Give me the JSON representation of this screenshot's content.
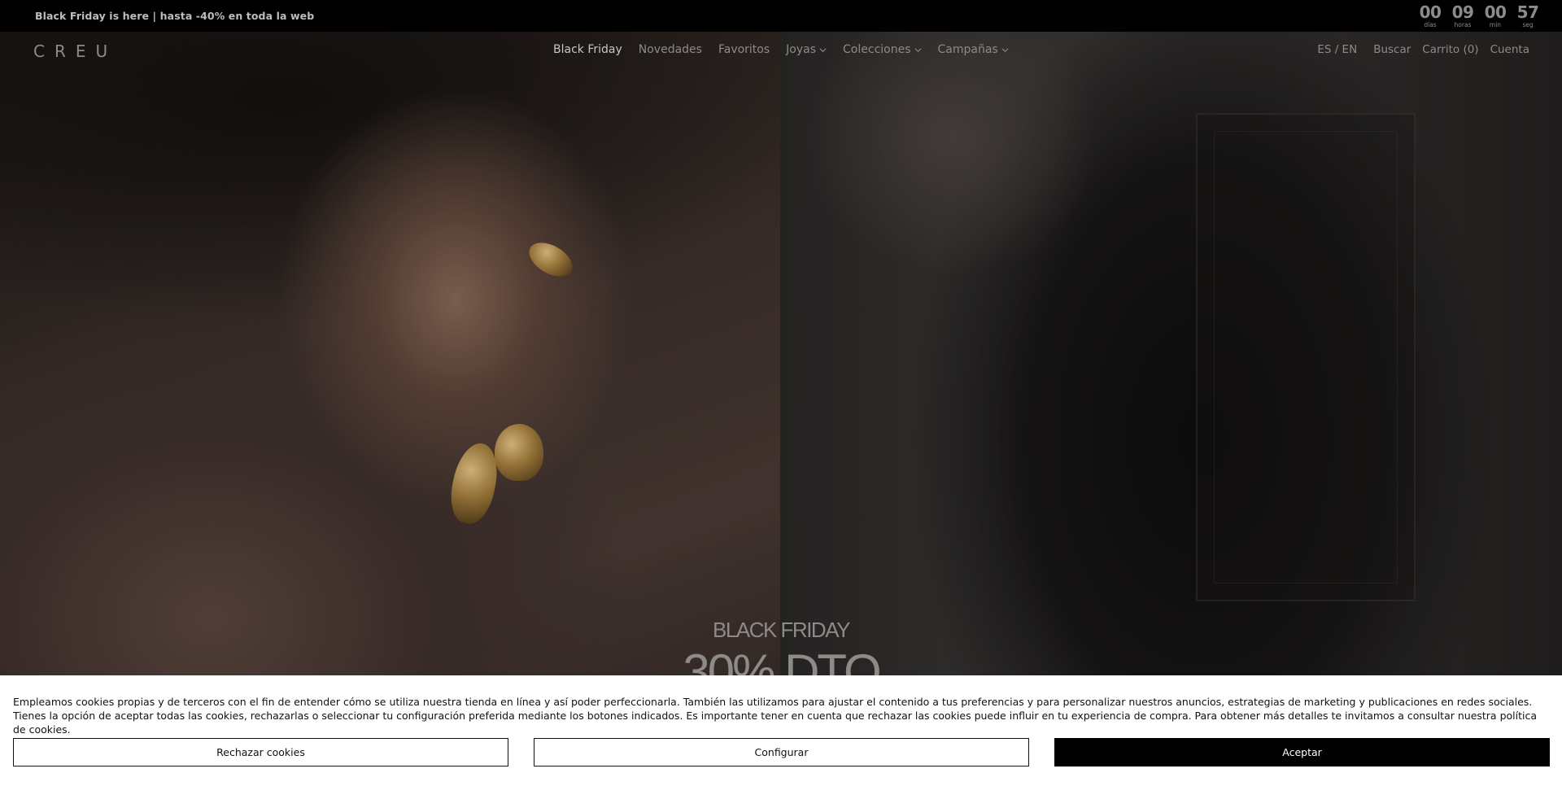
{
  "topbar": {
    "promo": "Black Friday is here | hasta -40% en toda la web",
    "countdown": [
      {
        "value": "00",
        "label": "días"
      },
      {
        "value": "09",
        "label": "horas"
      },
      {
        "value": "00",
        "label": "min"
      },
      {
        "value": "57",
        "label": "seg"
      }
    ]
  },
  "header": {
    "logo": "CREU",
    "nav": [
      {
        "label": "Black Friday",
        "dropdown": false
      },
      {
        "label": "Novedades",
        "dropdown": false
      },
      {
        "label": "Favoritos",
        "dropdown": false
      },
      {
        "label": "Joyas",
        "dropdown": true
      },
      {
        "label": "Colecciones",
        "dropdown": true
      },
      {
        "label": "Campañas",
        "dropdown": true
      }
    ],
    "language": "ES / EN",
    "search": "Buscar",
    "cart": "Carrito (0)",
    "account": "Cuenta"
  },
  "hero": {
    "kicker": "BLACK FRIDAY",
    "headline": "30% DTO"
  },
  "cookie": {
    "text": "Empleamos cookies propias y de terceros con el fin de entender cómo se utiliza nuestra tienda en línea y así poder perfeccionarla. También las utilizamos para ajustar el contenido a tus preferencias y para personalizar nuestros anuncios, estrategias de marketing y publicaciones en redes sociales. Tienes la opción de aceptar todas las cookies, rechazarlas o seleccionar tu configuración preferida mediante los botones indicados. Es importante tener en cuenta que rechazar las cookies puede influir en tu experiencia de compra. Para obtener más detalles te invitamos a consultar nuestra política de cookies.",
    "reject": "Rechazar cookies",
    "configure": "Configurar",
    "accept": "Aceptar"
  },
  "colors": {
    "topbar_bg": "#000000",
    "nav_text": "#8e8a88",
    "accept_bg": "#000000",
    "banner_bg": "#ffffff"
  }
}
